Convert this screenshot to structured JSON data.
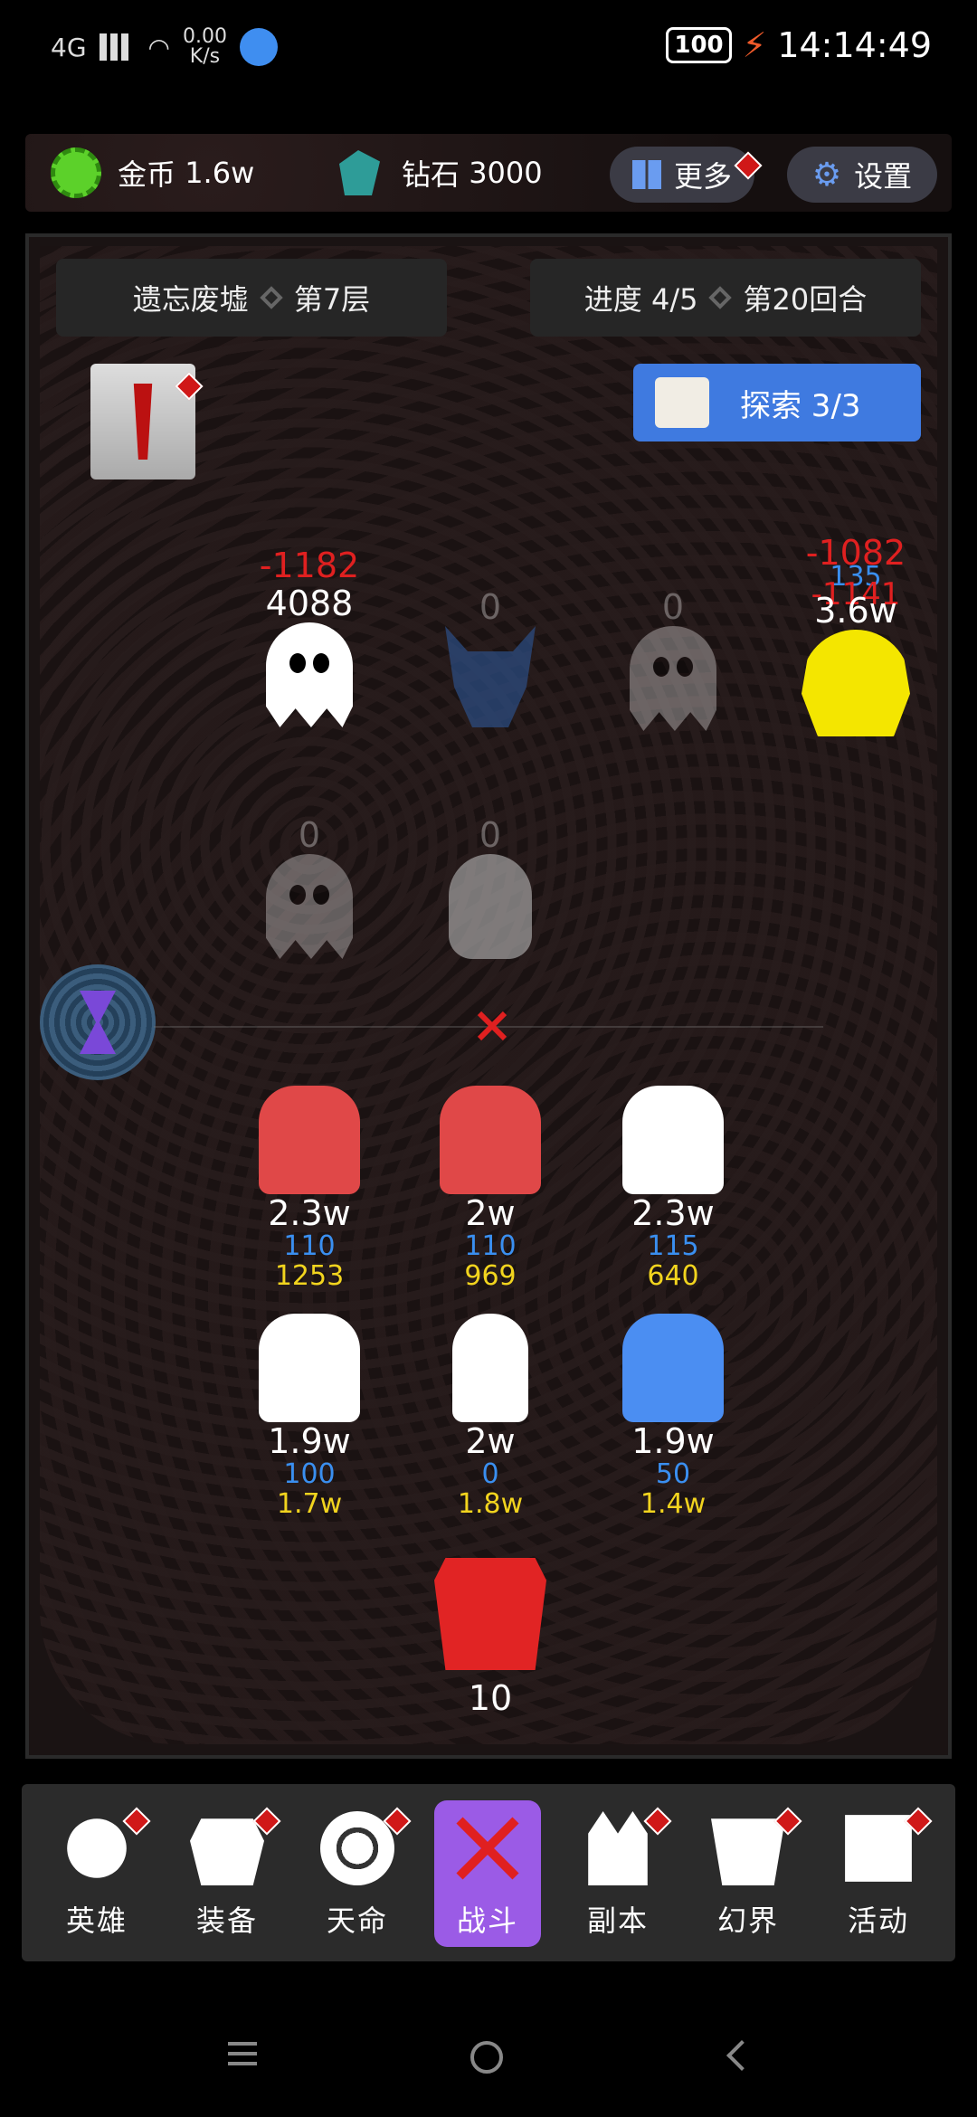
{
  "status": {
    "network": "4G",
    "speed_value": "0.00",
    "speed_unit": "K/s",
    "battery": "100",
    "time": "14:14:49"
  },
  "resources": {
    "coin_label": "金币",
    "coin_value": "1.6w",
    "diamond_label": "钻石",
    "diamond_value": "3000",
    "more_label": "更多",
    "settings_label": "设置"
  },
  "level": {
    "area": "遗忘废墟",
    "floor": "第7层",
    "progress": "进度 4/5",
    "round": "第20回合"
  },
  "explore": {
    "label": "探索 3/3"
  },
  "enemies": [
    {
      "id": "ghost-1",
      "damage": "-1182",
      "hp": "4088",
      "dim": false
    },
    {
      "id": "helmet",
      "hp": "0",
      "dim": true
    },
    {
      "id": "ghost-2",
      "hp": "0",
      "dim": true
    },
    {
      "id": "cthulhu",
      "damage": "-1082",
      "shield": "135",
      "damage2": "-1141",
      "hp": "3.6w",
      "dim": false
    },
    {
      "id": "ghost-3",
      "hp": "0",
      "dim": true
    },
    {
      "id": "skull",
      "hp": "0",
      "dim": true
    }
  ],
  "heroes": [
    {
      "id": "demon",
      "hp": "2.3w",
      "stat1": "110",
      "stat2": "1253"
    },
    {
      "id": "priest",
      "hp": "2w",
      "stat1": "110",
      "stat2": "969"
    },
    {
      "id": "knight",
      "hp": "2.3w",
      "stat1": "115",
      "stat2": "640"
    },
    {
      "id": "sage",
      "hp": "1.9w",
      "stat1": "100",
      "stat2": "1.7w"
    },
    {
      "id": "cyborg",
      "hp": "2w",
      "stat1": "0",
      "stat2": "1.8w"
    },
    {
      "id": "witch",
      "hp": "1.9w",
      "stat1": "50",
      "stat2": "1.4w"
    }
  ],
  "boss": {
    "value": "10"
  },
  "nav": [
    {
      "label": "英雄",
      "icon": "hero-icon",
      "active": false
    },
    {
      "label": "装备",
      "icon": "armor-icon",
      "active": false
    },
    {
      "label": "天命",
      "icon": "fate-icon",
      "active": false
    },
    {
      "label": "战斗",
      "icon": "battle-icon",
      "active": true
    },
    {
      "label": "副本",
      "icon": "dungeon-icon",
      "active": false
    },
    {
      "label": "幻界",
      "icon": "realm-icon",
      "active": false
    },
    {
      "label": "活动",
      "icon": "event-icon",
      "active": false
    }
  ],
  "colors": {
    "damage": "#e02020",
    "blue_stat": "#3a8ff0",
    "yellow_stat": "#f2d41e",
    "accent": "#3f7ae0",
    "nav_active": "#9b5be6"
  }
}
